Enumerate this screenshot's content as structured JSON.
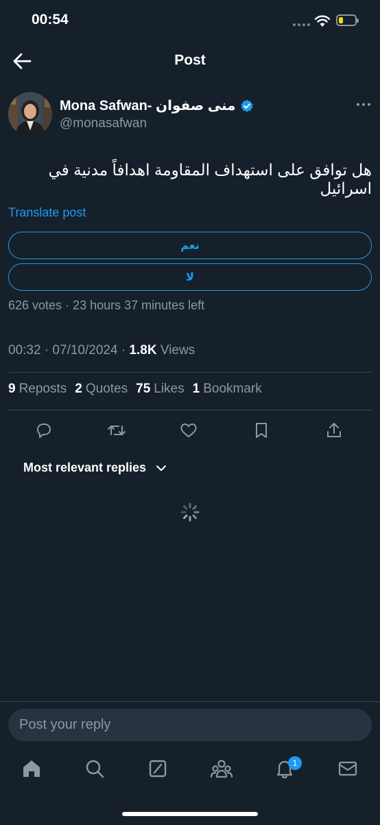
{
  "status": {
    "time": "00:54"
  },
  "header": {
    "title": "Post"
  },
  "post": {
    "author_name": "Mona Safwan- منى صفوان",
    "handle": "@monasafwan",
    "text": "هل توافق على استهداف المقاومة اهدافاً مدنية في اسرائيل",
    "translate": "Translate post",
    "poll": {
      "options": [
        "نعم",
        "لا"
      ],
      "meta": "626 votes · 23 hours 37 minutes left"
    },
    "date": "00:32 · 07/10/2024 · ",
    "views_count": "1.8K",
    "views_label": " Views",
    "stats": [
      {
        "count": "9",
        "label": "Reposts"
      },
      {
        "count": "2",
        "label": "Quotes"
      },
      {
        "count": "75",
        "label": "Likes"
      },
      {
        "count": "1",
        "label": "Bookmark"
      }
    ]
  },
  "replies": {
    "sort_label": "Most relevant replies"
  },
  "composer": {
    "placeholder": "Post your reply"
  },
  "nav": {
    "notifications_badge": "1"
  },
  "icons": {
    "back": "arrow-left-icon",
    "verified": "verified-badge-icon",
    "more": "more-dots-icon",
    "reply": "comment-icon",
    "repost": "repost-icon",
    "like": "heart-icon",
    "bookmark": "bookmark-icon",
    "share": "share-icon",
    "tabs": [
      "home-icon",
      "search-icon",
      "grok-icon",
      "communities-icon",
      "bell-icon",
      "mail-icon"
    ]
  },
  "colors": {
    "background": "#15202b",
    "accent": "#1d9bf0",
    "muted": "#8b98a5"
  }
}
